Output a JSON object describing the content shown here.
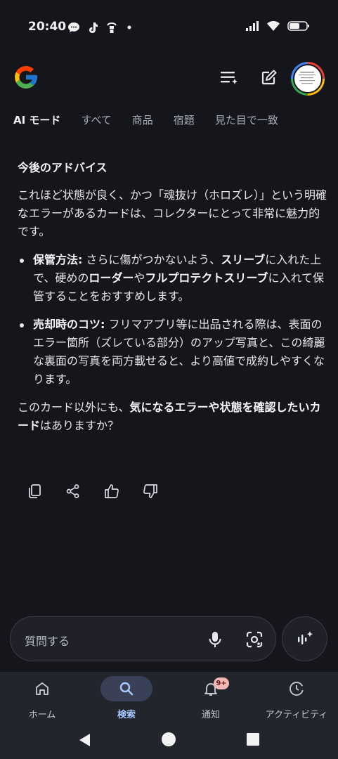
{
  "status_bar": {
    "time": "20:40"
  },
  "header": {
    "logo": "google-logo",
    "icons": [
      "history-icon",
      "edit-icon"
    ],
    "avatar": "profile-avatar"
  },
  "tabs": [
    {
      "label": "AI モード",
      "active": true
    },
    {
      "label": "すべて",
      "active": false
    },
    {
      "label": "商品",
      "active": false
    },
    {
      "label": "宿題",
      "active": false
    },
    {
      "label": "見た目で一致",
      "active": false
    }
  ],
  "content": {
    "title": "今後のアドバイス",
    "intro": "これほど状態が良く、かつ「魂抜け（ホロズレ）」という明確なエラーがあるカードは、コレクターにとって非常に魅力的です。",
    "bullet1": {
      "label": "保管方法:",
      "t1": " さらに傷がつかないよう、",
      "b1": "スリーブ",
      "t2": "に入れた上で、硬めの",
      "b2": "ローダー",
      "t3": "や",
      "b3": "フルプロテクトスリーブ",
      "t4": "に入れて保管することをおすすめします。"
    },
    "bullet2": {
      "label": "売却時のコツ:",
      "t1": " フリマアプリ等に出品される際は、表面のエラー箇所（ズレている部分）のアップ写真と、この綺麗な裏面の写真を両方載せると、より高値で成約しやすくなります。"
    },
    "closing": {
      "t1": "このカード以外にも、",
      "b1": "気になるエラーや状態を確認したいカード",
      "t2": "はありますか？"
    }
  },
  "actions": [
    "copy-icon",
    "share-icon",
    "thumbs-up-icon",
    "thumbs-down-icon"
  ],
  "ask": {
    "placeholder": "質問する"
  },
  "bottom_nav": [
    {
      "label": "ホーム",
      "icon": "home-icon",
      "active": false
    },
    {
      "label": "検索",
      "icon": "search-icon",
      "active": true
    },
    {
      "label": "通知",
      "icon": "bell-icon",
      "active": false,
      "badge": "9+"
    },
    {
      "label": "アクティビティ",
      "icon": "activity-icon",
      "active": false
    }
  ],
  "colors": {
    "background": "#15161c",
    "nav_background": "#23252d",
    "active_accent": "#aac7ff",
    "badge": "#f2b8b5"
  }
}
